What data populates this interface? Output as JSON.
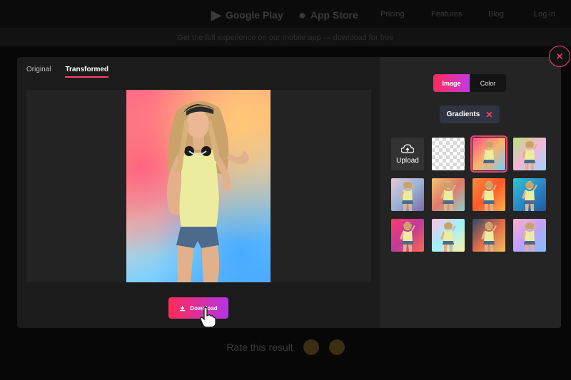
{
  "background": {
    "store_badges": [
      "Google Play",
      "App Store"
    ],
    "nav_items": [
      "Pricing",
      "Features",
      "Blog",
      "Log in"
    ],
    "banner_text": "Get the full experience on our mobile app — download for free",
    "feedback_label": "Rate this result"
  },
  "modal": {
    "tabs": [
      {
        "label": "Original",
        "active": false
      },
      {
        "label": "Transformed",
        "active": true
      }
    ],
    "download_label": "Download",
    "toggle": [
      {
        "label": "Image",
        "active": true
      },
      {
        "label": "Color",
        "active": false
      }
    ],
    "category_chip": {
      "label": "Gradients"
    },
    "upload_label": "Upload",
    "backgrounds": [
      {
        "type": "upload"
      },
      {
        "type": "transparent"
      },
      {
        "type": "gradient",
        "colors": [
          "#ff4d8a",
          "#ffb36b",
          "#6bd0ff"
        ],
        "selected": true
      },
      {
        "type": "gradient",
        "colors": [
          "#b8e27a",
          "#f3b6d6",
          "#9ad8ff"
        ]
      },
      {
        "type": "gradient",
        "colors": [
          "#e6c7d8",
          "#9ab4d6",
          "#7a6aa8"
        ]
      },
      {
        "type": "gradient",
        "colors": [
          "#f0c470",
          "#e07a6a",
          "#8fd2c8"
        ]
      },
      {
        "type": "gradient",
        "colors": [
          "#ff8a3a",
          "#ff5a2a",
          "#ffb24a"
        ]
      },
      {
        "type": "gradient",
        "colors": [
          "#2ec8d0",
          "#2a8ac8",
          "#1f5aa0"
        ]
      },
      {
        "type": "gradient",
        "colors": [
          "#ff3a6a",
          "#c23a9a",
          "#ff6a4a"
        ]
      },
      {
        "type": "gradient",
        "colors": [
          "#ffc0e0",
          "#a0f0ff",
          "#fff3a0"
        ]
      },
      {
        "type": "gradient",
        "colors": [
          "#2a4a6a",
          "#e06a4a",
          "#f0c060"
        ]
      },
      {
        "type": "gradient",
        "colors": [
          "#ffb0c8",
          "#c0a0ff",
          "#80c0ff"
        ]
      }
    ]
  },
  "colors": {
    "accent_pink": "#ff3d6e",
    "accent_purple": "#b434e6",
    "modal_bg": "#1b1b1b",
    "panel_bg": "#242424"
  }
}
